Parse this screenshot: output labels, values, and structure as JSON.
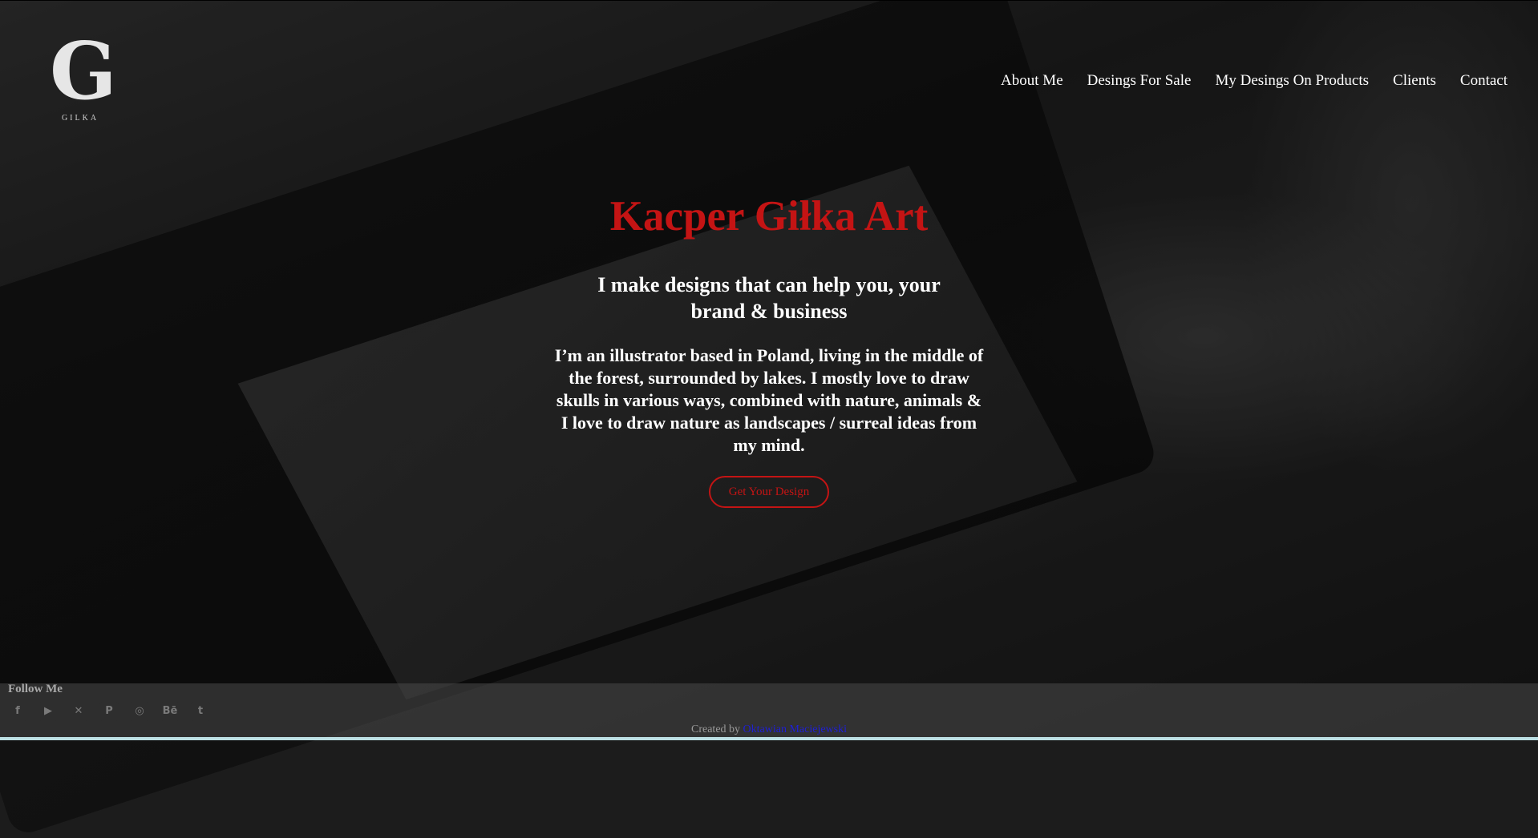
{
  "logo": {
    "glyph": "G",
    "text": "GILKA"
  },
  "nav": {
    "items": [
      {
        "label": "About Me"
      },
      {
        "label": "Desings For Sale"
      },
      {
        "label": "My Desings On Products"
      },
      {
        "label": "Clients"
      },
      {
        "label": "Contact"
      }
    ]
  },
  "hero": {
    "title": "Kacper Giłka Art",
    "subtitle": "I make designs that can help you, your brand & business",
    "bio": "I’m an illustrator based in Poland, living in the middle of the forest, surrounded by lakes. I mostly love to draw skulls in various ways, combined with nature, animals & I love to draw nature as landscapes / surreal ideas from my mind.",
    "cta_label": "Get Your Design"
  },
  "footer": {
    "follow_label": "Follow Me",
    "social": [
      {
        "icon": "facebook-icon",
        "glyph": "f"
      },
      {
        "icon": "youtube-icon",
        "glyph": "▶"
      },
      {
        "icon": "tools-icon",
        "glyph": "✕"
      },
      {
        "icon": "pinterest-icon",
        "glyph": "P"
      },
      {
        "icon": "instagram-icon",
        "glyph": "◎"
      },
      {
        "icon": "behance-icon",
        "glyph": "Bē"
      },
      {
        "icon": "tumblr-icon",
        "glyph": "t"
      }
    ],
    "credit_prefix": "Created by",
    "credit_name": "Oktawian Maciejewski"
  },
  "colors": {
    "accent": "#c41414",
    "link": "#1f1fd6",
    "text": "#ffffff"
  }
}
